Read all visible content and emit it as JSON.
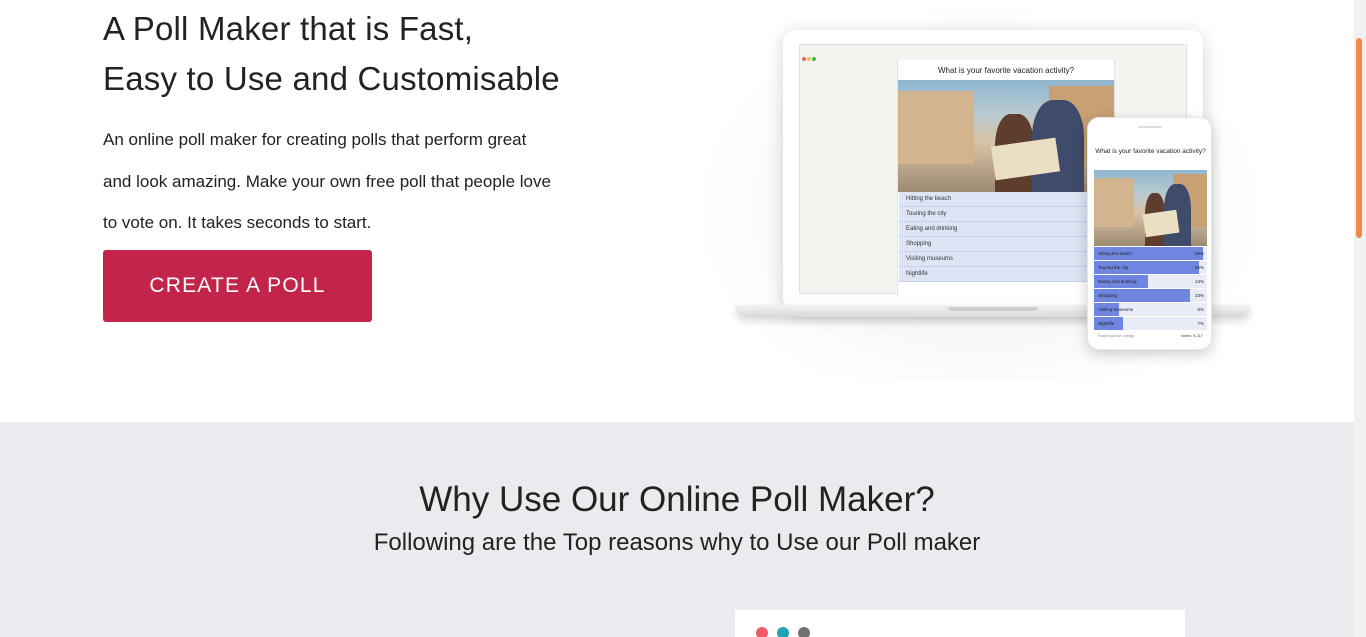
{
  "hero": {
    "title_line1": "A Poll Maker that is Fast,",
    "title_line2": "Easy to Use and Customisable",
    "description": "An online poll maker for creating polls that perform great and look amazing. Make your own free poll that people love to vote on. It takes seconds to start.",
    "cta_label": "CREATE A POLL",
    "cta_color": "#c3244a"
  },
  "mockup": {
    "laptop": {
      "question": "What is your favorite vacation activity?",
      "options": [
        "Hitting the beach",
        "Touring the city",
        "Eating and drinking",
        "Shopping",
        "Visiting museums",
        "Nightlife"
      ],
      "votes_text": "Votes: 9,2"
    },
    "phone": {
      "question": "What is your favorite vacation activity?",
      "results": [
        {
          "label": "Hitting the beach",
          "pct": "26%",
          "value": 26
        },
        {
          "label": "Touring the city",
          "pct": "25%",
          "value": 25
        },
        {
          "label": "Eating and drinking",
          "pct": "13%",
          "value": 13
        },
        {
          "label": "Shopping",
          "pct": "23%",
          "value": 23
        },
        {
          "label": "Visiting museums",
          "pct": "6%",
          "value": 6
        },
        {
          "label": "Nightlife",
          "pct": "7%",
          "value": 7
        }
      ],
      "thanks_text": "Thank you for voting!",
      "votes_text": "Votes: 9,217",
      "bar_color": "#6f86e0"
    }
  },
  "features": {
    "title": "Why Use Our Online Poll Maker?",
    "subtitle": "Following are the Top reasons why to Use our Poll maker",
    "window_dot_colors": [
      "#ef5b67",
      "#1fa2b4",
      "#707070"
    ]
  },
  "scrollbar": {
    "thumb_color": "#f08a4b"
  }
}
